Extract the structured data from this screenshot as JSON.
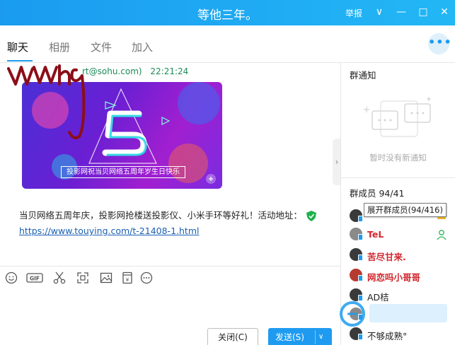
{
  "window": {
    "title": "等他三年。",
    "report_label": "举报",
    "controls": [
      "∨",
      "—",
      "□",
      "✕"
    ]
  },
  "tabs": [
    {
      "label": "聊天",
      "active": true
    },
    {
      "label": "相册",
      "active": false
    },
    {
      "label": "文件",
      "active": false
    },
    {
      "label": "加入",
      "active": false
    }
  ],
  "more_label": "•••",
  "chat": {
    "sender_email": "rt@sohu.com)",
    "sender_time": "22:21:24",
    "banner_caption": "投影网祝当贝网络五周年岁生日快乐",
    "message_text": "当贝网络五周年庆，投影网抢楼送投影仪、小米手环等好礼！活动地址：",
    "message_link": "https://www.touying.com/t-21408-1.html"
  },
  "toolbar": {
    "icons": [
      "smile-icon",
      "gif-icon",
      "scissors-icon",
      "screenshot-icon",
      "image-icon",
      "red-packet-icon",
      "more-icon"
    ]
  },
  "buttons": {
    "close_label": "关闭(C)",
    "send_label": "发送(S)"
  },
  "notice": {
    "title": "群通知",
    "empty_text": "暂时没有新通知"
  },
  "members": {
    "title": "群成员 94/41",
    "tooltip": "展开群成员(94/416)",
    "list": [
      {
        "name": "",
        "style": "plain"
      },
      {
        "name": "TeL",
        "style": "red"
      },
      {
        "name": "苦尽甘来.",
        "style": "red"
      },
      {
        "name": "网恋吗小哥哥",
        "style": "red"
      },
      {
        "name": "AD桔",
        "style": "plain"
      },
      {
        "name": "",
        "style": "plain"
      },
      {
        "name": "不够成熟°",
        "style": "plain"
      }
    ]
  },
  "colors": {
    "title_bar": "#1a9bf0",
    "accent": "#1e9bf0",
    "member_highlight": "#d0262c",
    "link": "#1a5fb4"
  }
}
